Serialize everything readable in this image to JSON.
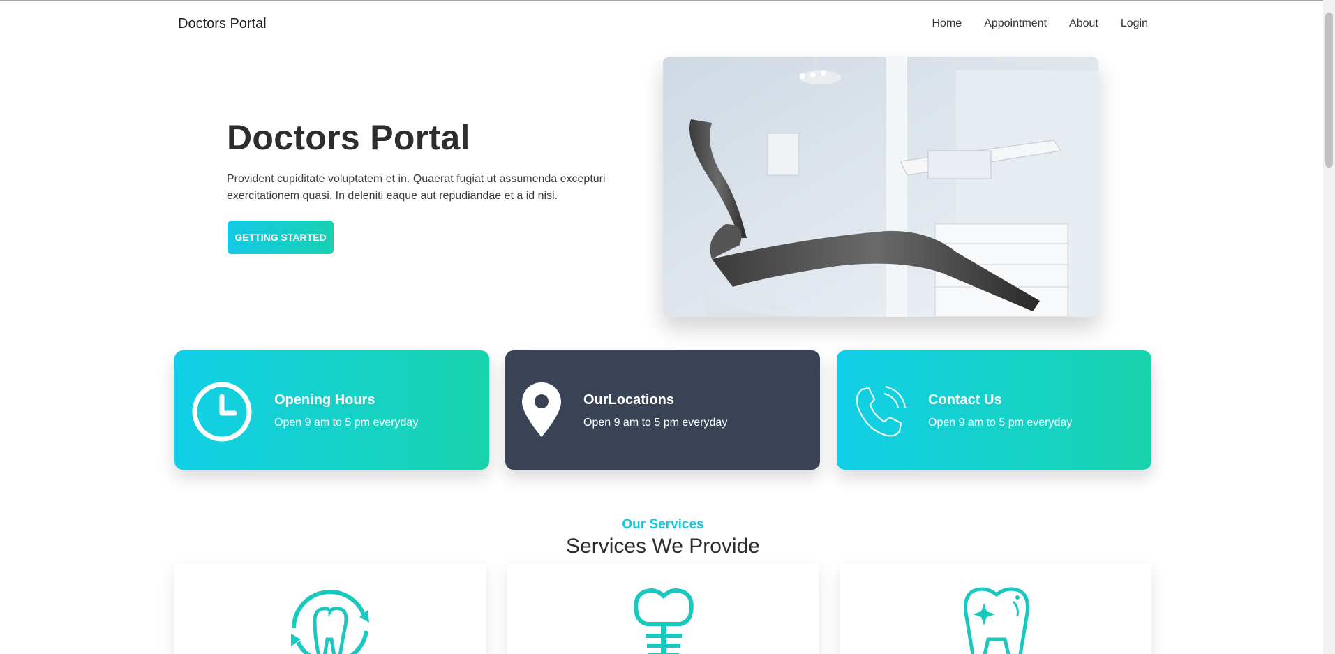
{
  "navbar": {
    "brand": "Doctors Portal",
    "links": [
      "Home",
      "Appointment",
      "About",
      "Login"
    ]
  },
  "hero": {
    "title": "Doctors Portal",
    "text": "Provident cupiditate voluptatem et in. Quaerat fugiat ut assumenda excepturi exercitationem quasi. In deleniti eaque aut repudiandae et a id nisi.",
    "button_label": "GETTING STARTED"
  },
  "info_cards": [
    {
      "title": "Opening Hours",
      "text": "Open 9 am to 5 pm everyday",
      "icon": "clock-icon",
      "style": "gradient"
    },
    {
      "title": "OurLocations",
      "text": "Open 9 am to 5 pm everyday",
      "icon": "location-pin-icon",
      "style": "dark"
    },
    {
      "title": "Contact Us",
      "text": "Open 9 am to 5 pm everyday",
      "icon": "phone-icon",
      "style": "gradient"
    }
  ],
  "services": {
    "subtitle": "Our Services",
    "title": "Services We Provide",
    "items": [
      {
        "icon": "tooth-cleaning-icon"
      },
      {
        "icon": "dental-implant-icon"
      },
      {
        "icon": "tooth-whitening-icon"
      }
    ]
  },
  "colors": {
    "accent": "#13c9e6",
    "accent_green": "#19d3ac",
    "dark": "#3a4256"
  }
}
